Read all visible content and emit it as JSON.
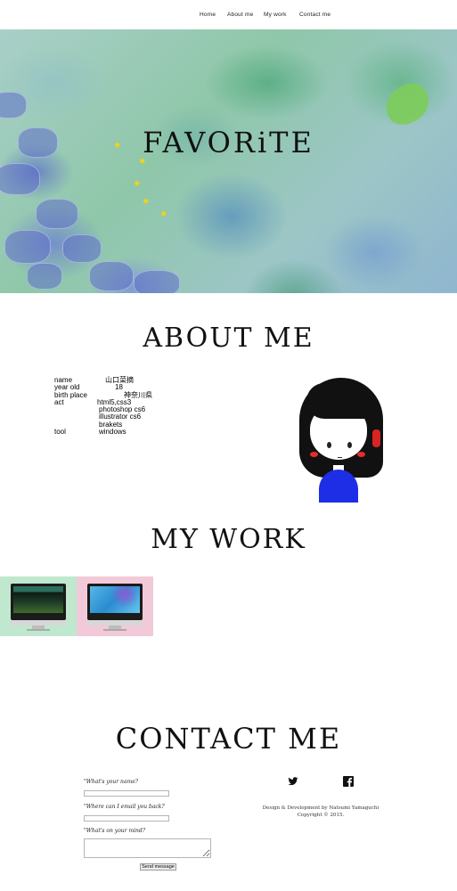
{
  "nav": {
    "items": [
      {
        "label": "Home"
      },
      {
        "label": "About me"
      },
      {
        "label": "My work"
      },
      {
        "label": "Contact me"
      }
    ]
  },
  "hero": {
    "title": "FAVORiTE"
  },
  "about": {
    "heading": "ABOUT ME",
    "rows": [
      {
        "key": "name",
        "value": "山口菜摘"
      },
      {
        "key": "year old",
        "value": "18"
      },
      {
        "key": "birth place",
        "value": "神奈川県"
      },
      {
        "key": "act",
        "value": "html5,css3"
      },
      {
        "key": "",
        "value": "photoshop cs6"
      },
      {
        "key": "",
        "value": "illustrator cs6"
      },
      {
        "key": "",
        "value": "brakets"
      },
      {
        "key": "tool",
        "value": "windows"
      }
    ]
  },
  "work": {
    "heading": "MY WORK",
    "items": [
      {
        "bg": "#bfe8cf"
      },
      {
        "bg": "#f2c9d8"
      }
    ]
  },
  "contact": {
    "heading": "CONTACT ME",
    "name_label": "\"What's your name?",
    "email_label": "\"Where can I email you back?",
    "message_label": "\"What's on your mind?",
    "send_label": "Send message",
    "credit_line1": "Design & Development by Natsumi Yamaguchi",
    "credit_line2": "Copyright © 2015."
  },
  "social": {
    "twitter_icon": "twitter-icon",
    "facebook_icon": "facebook-icon"
  }
}
